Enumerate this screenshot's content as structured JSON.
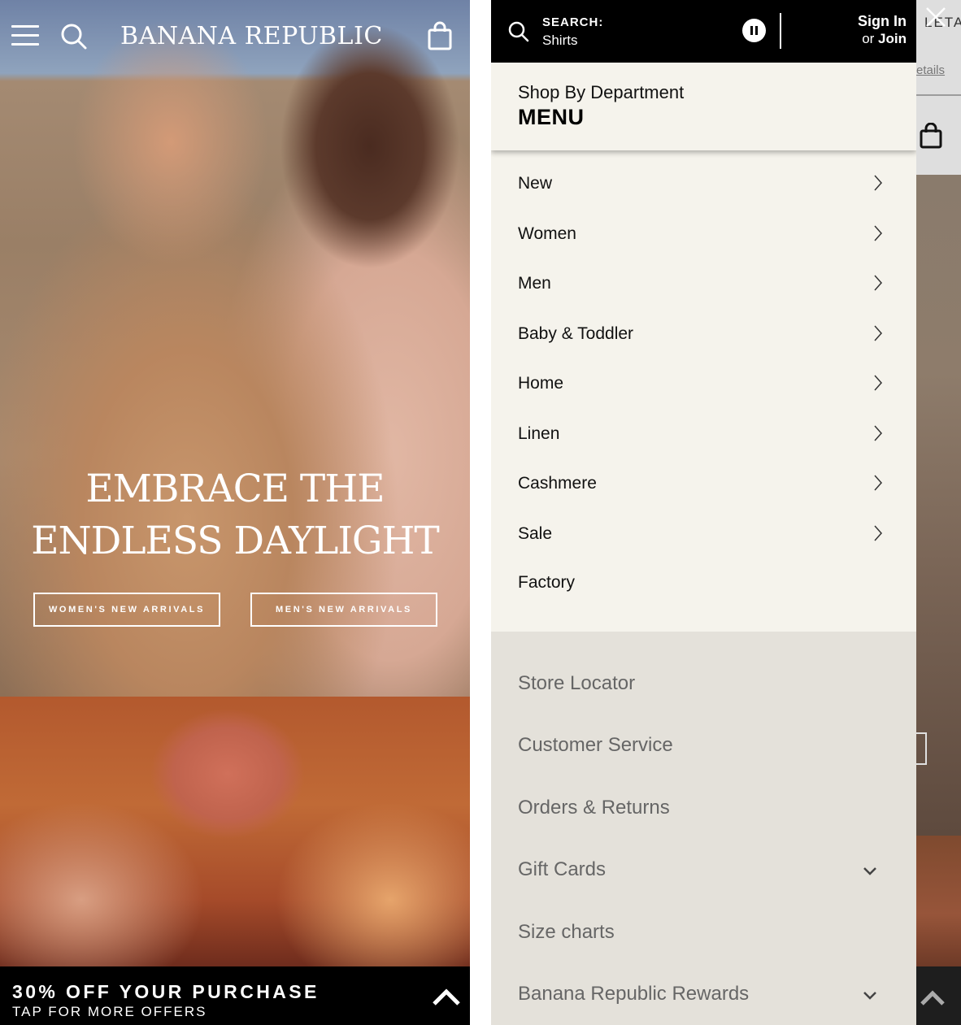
{
  "left_screen": {
    "brand": "BANANA REPUBLIC",
    "headline_line1": "EMBRACE THE",
    "headline_line2": "ENDLESS DAYLIGHT",
    "cta_women": "WOMEN'S NEW ARRIVALS",
    "cta_men": "MEN'S NEW ARRIVALS",
    "promo_title": "30% OFF YOUR PURCHASE",
    "promo_subtitle": "TAP FOR MORE OFFERS"
  },
  "drawer": {
    "search_label": "SEARCH:",
    "search_placeholder": "Shirts",
    "sign_in": "Sign In",
    "or_text": "or",
    "join": "Join",
    "dept_subtitle": "Shop By Department",
    "dept_title": "MENU",
    "menu_items": [
      {
        "label": "New",
        "has_chevron": true
      },
      {
        "label": "Women",
        "has_chevron": true
      },
      {
        "label": "Men",
        "has_chevron": true
      },
      {
        "label": "Baby & Toddler",
        "has_chevron": true
      },
      {
        "label": "Home",
        "has_chevron": true
      },
      {
        "label": "Linen",
        "has_chevron": true
      },
      {
        "label": "Cashmere",
        "has_chevron": true
      },
      {
        "label": "Sale",
        "has_chevron": true
      },
      {
        "label": "Factory",
        "has_chevron": false
      }
    ],
    "secondary_items": [
      {
        "label": "Store Locator",
        "expandable": false
      },
      {
        "label": "Customer Service",
        "expandable": false
      },
      {
        "label": "Orders & Returns",
        "expandable": false
      },
      {
        "label": "Gift Cards",
        "expandable": true
      },
      {
        "label": "Size charts",
        "expandable": false
      },
      {
        "label": "Banana Republic Rewards",
        "expandable": true
      }
    ]
  },
  "background_page": {
    "title_fragment": "LETA",
    "link_fragment": "etails"
  },
  "icons": {
    "menu": "hamburger-icon",
    "search": "search-icon",
    "bag": "shopping-bag-icon",
    "pause": "pause-icon",
    "close": "close-icon",
    "chevron_right": "chevron-right-icon",
    "chevron_down": "chevron-down-icon",
    "chevron_up": "chevron-up-icon"
  },
  "colors": {
    "drawer_bg": "#f5f3ec",
    "secondary_bg": "#e4e1da",
    "header_bg": "#000000"
  }
}
